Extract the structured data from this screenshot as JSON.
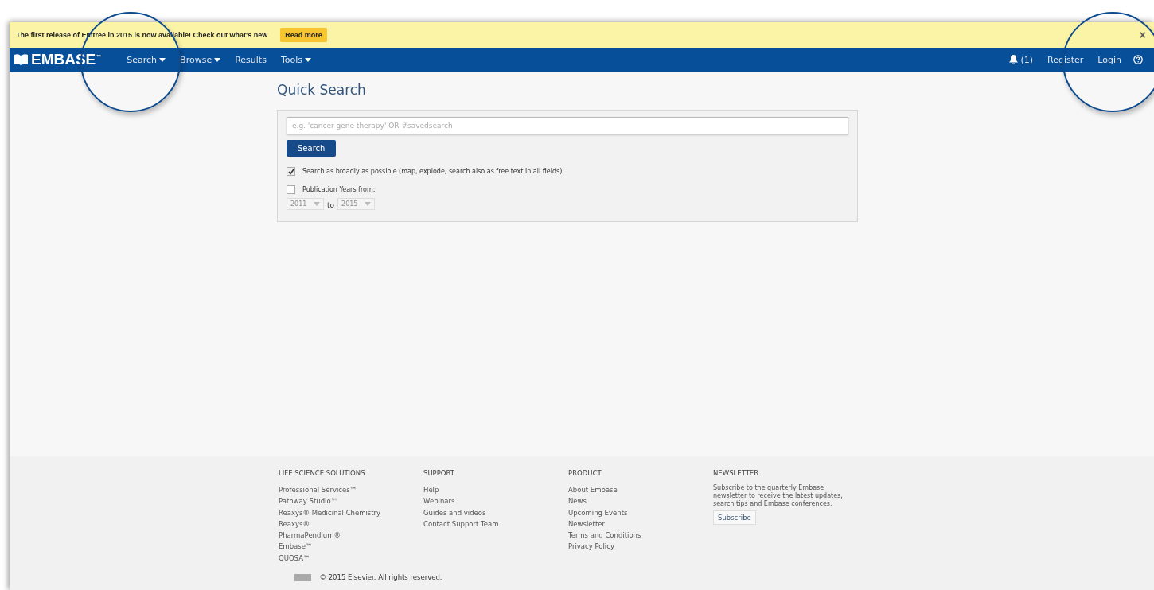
{
  "banner": {
    "message": "The first release of Emtree in 2015 is now available! Check out what's new",
    "button": "Read more",
    "close": "×"
  },
  "nav": {
    "logo": "EMBASE",
    "trademark": "™",
    "items": [
      {
        "label": "Search",
        "dropdown": true
      },
      {
        "label": "Browse",
        "dropdown": true
      },
      {
        "label": "Results",
        "dropdown": false
      },
      {
        "label": "Tools",
        "dropdown": true
      }
    ],
    "notifications": "(1)",
    "right_links": [
      "Register",
      "Login"
    ]
  },
  "quick_search": {
    "title": "Quick Search",
    "placeholder": "e.g. 'cancer gene therapy' OR #savedsearch",
    "button": "Search",
    "options": [
      {
        "label": "Search as broadly as possible (map, explode, search also as free text in all fields)",
        "checked": true
      },
      {
        "label": "Publication Years from:",
        "checked": false
      }
    ],
    "year_from": "2011",
    "year_to": "2015",
    "to_label": "to",
    "years_disabled": true
  },
  "footer": {
    "columns": [
      {
        "heading": "LIFE SCIENCE SOLUTIONS",
        "links": [
          "Professional Services™",
          "Pathway Studio™",
          "Reaxys® Medicinal Chemistry",
          "Reaxys®",
          "PharmaPendium®",
          "Embase™",
          "QUOSA™"
        ]
      },
      {
        "heading": "SUPPORT",
        "links": [
          "Help",
          "Webinars",
          "Guides and videos",
          "Contact Support Team"
        ]
      },
      {
        "heading": "PRODUCT",
        "links": [
          "About Embase",
          "News",
          "Upcoming Events",
          "Newsletter",
          "Terms and Conditions",
          "Privacy Policy"
        ]
      }
    ],
    "newsletter": {
      "heading": "NEWSLETTER",
      "text": "Subscribe to the quarterly Embase newsletter to receive the latest updates, search tips and Embase conferences.",
      "button": "Subscribe"
    },
    "copyright": "© 2015 Elsevier. All rights reserved."
  }
}
